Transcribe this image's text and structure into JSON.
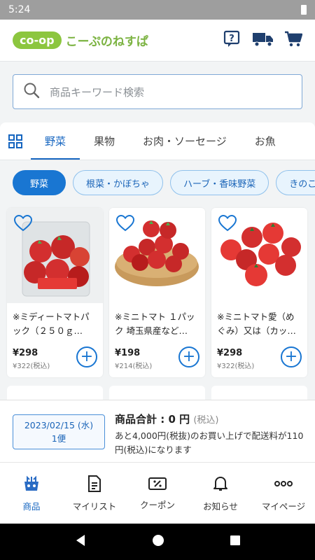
{
  "status_bar": {
    "time": "5:24"
  },
  "header": {
    "logo_pill": "co-op",
    "logo_text": "こーぷのねすぱ"
  },
  "search": {
    "placeholder": "商品キーワード検索"
  },
  "category_tabs": [
    {
      "label": "野菜",
      "active": true
    },
    {
      "label": "果物",
      "active": false
    },
    {
      "label": "お肉・ソーセージ",
      "active": false
    },
    {
      "label": "お魚",
      "active": false
    }
  ],
  "sub_chips": [
    {
      "label": "野菜",
      "active": true
    },
    {
      "label": "根菜・かぼちゃ",
      "active": false
    },
    {
      "label": "ハーブ・香味野菜",
      "active": false
    },
    {
      "label": "きのこ",
      "active": false
    }
  ],
  "products": [
    {
      "name": "※ミディートマトパック（２５０ｇ…",
      "price": "¥298",
      "price_tax": "¥322(税込)"
    },
    {
      "name": "※ミニトマト １パック 埼玉県産など…",
      "price": "¥198",
      "price_tax": "¥214(税込)"
    },
    {
      "name": "※ミニトマト愛（めぐみ）又は（カッ…",
      "price": "¥298",
      "price_tax": "¥322(税込)"
    }
  ],
  "summary": {
    "delivery_date": "2023/02/15 (水)",
    "delivery_slot": "1便",
    "total_label": "商品合計 : 0 円",
    "total_tax": "(税込)",
    "note": "あと4,000円(税抜)のお買い上げで配送料が110円(税込)になります"
  },
  "bottom_nav": [
    {
      "label": "商品",
      "icon": "basket-icon",
      "active": true
    },
    {
      "label": "マイリスト",
      "icon": "list-icon",
      "active": false
    },
    {
      "label": "クーポン",
      "icon": "coupon-icon",
      "active": false
    },
    {
      "label": "お知らせ",
      "icon": "bell-icon",
      "active": false
    },
    {
      "label": "マイページ",
      "icon": "more-icon",
      "active": false
    }
  ],
  "colors": {
    "accent": "#1976d2",
    "logo_green": "#8cc63f",
    "header_icons": "#1f3f6e"
  }
}
